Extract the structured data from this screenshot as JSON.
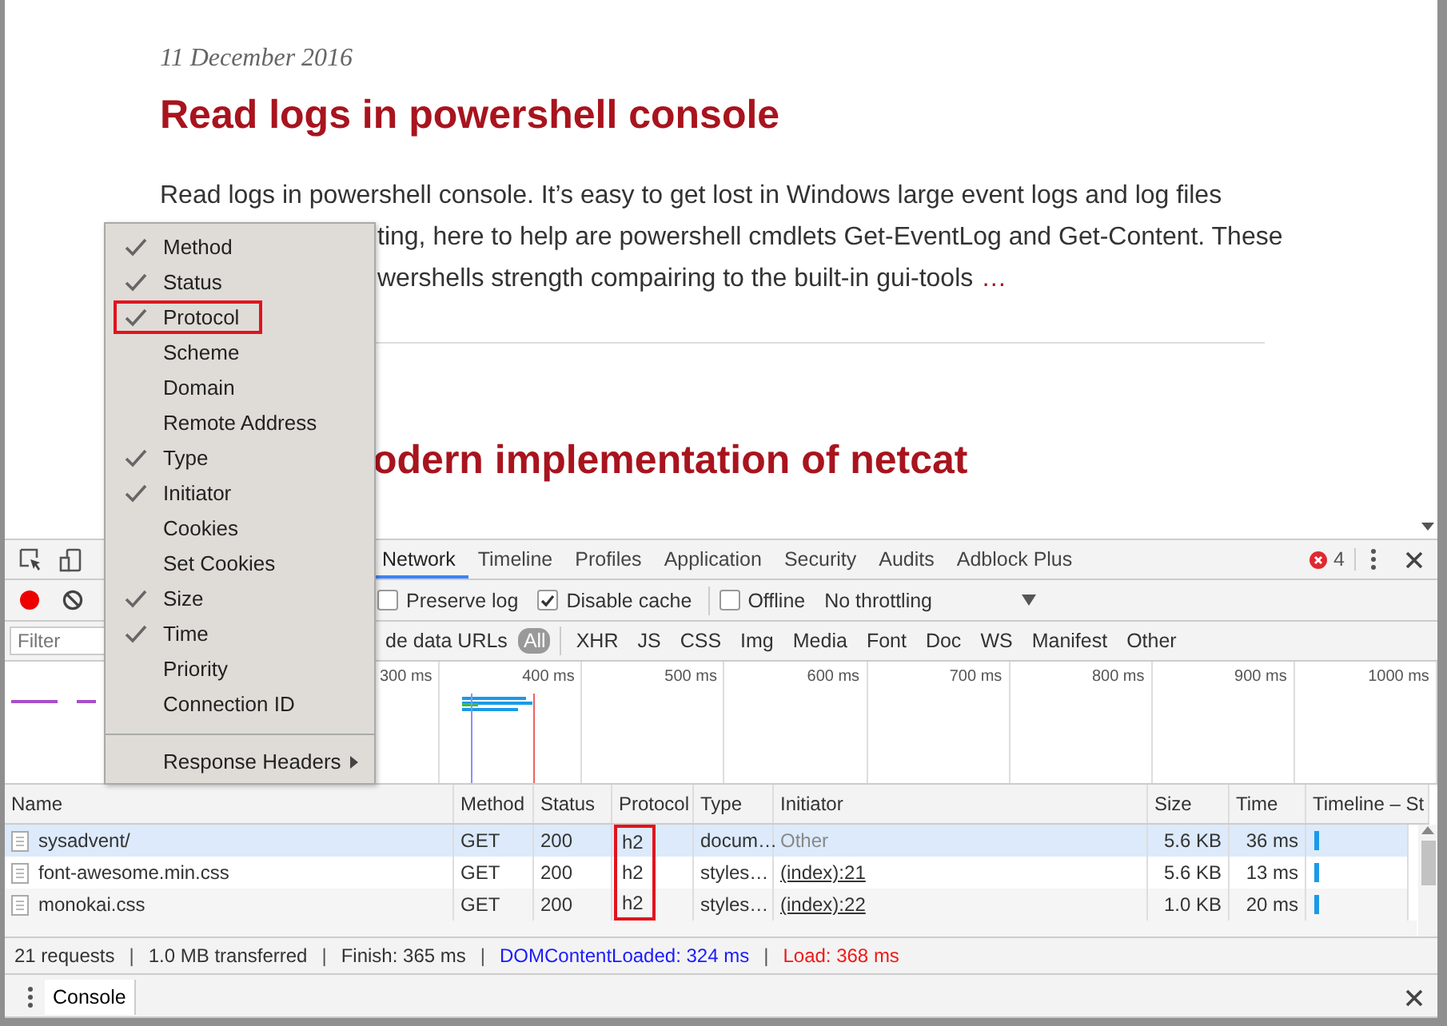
{
  "page": {
    "date": "11 December 2016",
    "title": "Read logs in powershell console",
    "excerpt_lines": [
      "Read logs in powershell console. It’s easy to get lost in Windows large event logs and log files",
      "ting, here to help are powershell cmdlets Get-EventLog and Get-Content. These",
      "wershells strength compairing to the built-in gui-tools"
    ],
    "more_link": "…",
    "next_title": "odern implementation of netcat"
  },
  "devtools": {
    "tabs": [
      {
        "label": "Network",
        "selected": true
      },
      {
        "label": "Timeline",
        "selected": false
      },
      {
        "label": "Profiles",
        "selected": false
      },
      {
        "label": "Application",
        "selected": false
      },
      {
        "label": "Security",
        "selected": false
      },
      {
        "label": "Audits",
        "selected": false
      },
      {
        "label": "Adblock Plus",
        "selected": false
      }
    ],
    "error_count": "4",
    "recording": true,
    "options": [
      {
        "label": "Preserve log",
        "checked": false
      },
      {
        "label": "Disable cache",
        "checked": true
      },
      {
        "label": "Offline",
        "checked": false
      }
    ],
    "throttling": "No throttling",
    "filter": {
      "placeholder": "Filter"
    },
    "data_urls_label": "de data URLs",
    "types": [
      {
        "label": "All",
        "selected": true
      },
      {
        "label": "XHR",
        "selected": false
      },
      {
        "label": "JS",
        "selected": false
      },
      {
        "label": "CSS",
        "selected": false
      },
      {
        "label": "Img",
        "selected": false
      },
      {
        "label": "Media",
        "selected": false
      },
      {
        "label": "Font",
        "selected": false
      },
      {
        "label": "Doc",
        "selected": false
      },
      {
        "label": "WS",
        "selected": false
      },
      {
        "label": "Manifest",
        "selected": false
      },
      {
        "label": "Other",
        "selected": false
      }
    ],
    "overview_ticks": [
      "300 ms",
      "400 ms",
      "500 ms",
      "600 ms",
      "700 ms",
      "800 ms",
      "900 ms",
      "1000 ms"
    ],
    "table": {
      "columns": [
        "Name",
        "Method",
        "Status",
        "Protocol",
        "Type",
        "Initiator",
        "Size",
        "Time",
        "Timeline – St"
      ],
      "rows": [
        {
          "name": "sysadvent/",
          "method": "GET",
          "status": "200",
          "protocol": "h2",
          "protocol_marked": true,
          "type": "docum…",
          "initiator": "Other",
          "initiator_link": false,
          "size": "5.6 KB",
          "time": "36 ms",
          "selected": true
        },
        {
          "name": "font-awesome.min.css",
          "method": "GET",
          "status": "200",
          "protocol": "h2",
          "protocol_marked": true,
          "type": "styles…",
          "initiator": "(index):21",
          "initiator_link": true,
          "size": "5.6 KB",
          "time": "13 ms",
          "selected": false
        },
        {
          "name": "monokai.css",
          "method": "GET",
          "status": "200",
          "protocol": "h2",
          "protocol_marked": true,
          "type": "styles…",
          "initiator": "(index):22",
          "initiator_link": true,
          "size": "1.0 KB",
          "time": "20 ms",
          "selected": false
        }
      ]
    },
    "summary": [
      {
        "text": "21 requests",
        "kind": "plain"
      },
      {
        "text": "1.0 MB transferred",
        "kind": "plain"
      },
      {
        "text": "Finish: 365 ms",
        "kind": "plain"
      },
      {
        "text": "DOMContentLoaded: 324 ms",
        "kind": "dom"
      },
      {
        "text": "Load: 368 ms",
        "kind": "load"
      }
    ],
    "summary_separator": "|",
    "drawer_tabs": [
      {
        "label": "Console",
        "selected": true
      }
    ]
  },
  "context_menu": {
    "items": [
      {
        "label": "Method",
        "kind": "check",
        "checked": true,
        "highlighted": false
      },
      {
        "label": "Status",
        "kind": "check",
        "checked": true,
        "highlighted": false
      },
      {
        "label": "Protocol",
        "kind": "check",
        "checked": true,
        "highlighted": true
      },
      {
        "label": "Scheme",
        "kind": "check",
        "checked": false,
        "highlighted": false
      },
      {
        "label": "Domain",
        "kind": "check",
        "checked": false,
        "highlighted": false
      },
      {
        "label": "Remote Address",
        "kind": "check",
        "checked": false,
        "highlighted": false
      },
      {
        "label": "Type",
        "kind": "check",
        "checked": true,
        "highlighted": false
      },
      {
        "label": "Initiator",
        "kind": "check",
        "checked": true,
        "highlighted": false
      },
      {
        "label": "Cookies",
        "kind": "check",
        "checked": false,
        "highlighted": false
      },
      {
        "label": "Set Cookies",
        "kind": "check",
        "checked": false,
        "highlighted": false
      },
      {
        "label": "Size",
        "kind": "check",
        "checked": true,
        "highlighted": false
      },
      {
        "label": "Time",
        "kind": "check",
        "checked": true,
        "highlighted": false
      },
      {
        "label": "Priority",
        "kind": "check",
        "checked": false,
        "highlighted": false
      },
      {
        "label": "Connection ID",
        "kind": "check",
        "checked": false,
        "highlighted": false
      },
      {
        "label": "Response Headers",
        "kind": "submenu",
        "highlighted": false
      }
    ]
  }
}
